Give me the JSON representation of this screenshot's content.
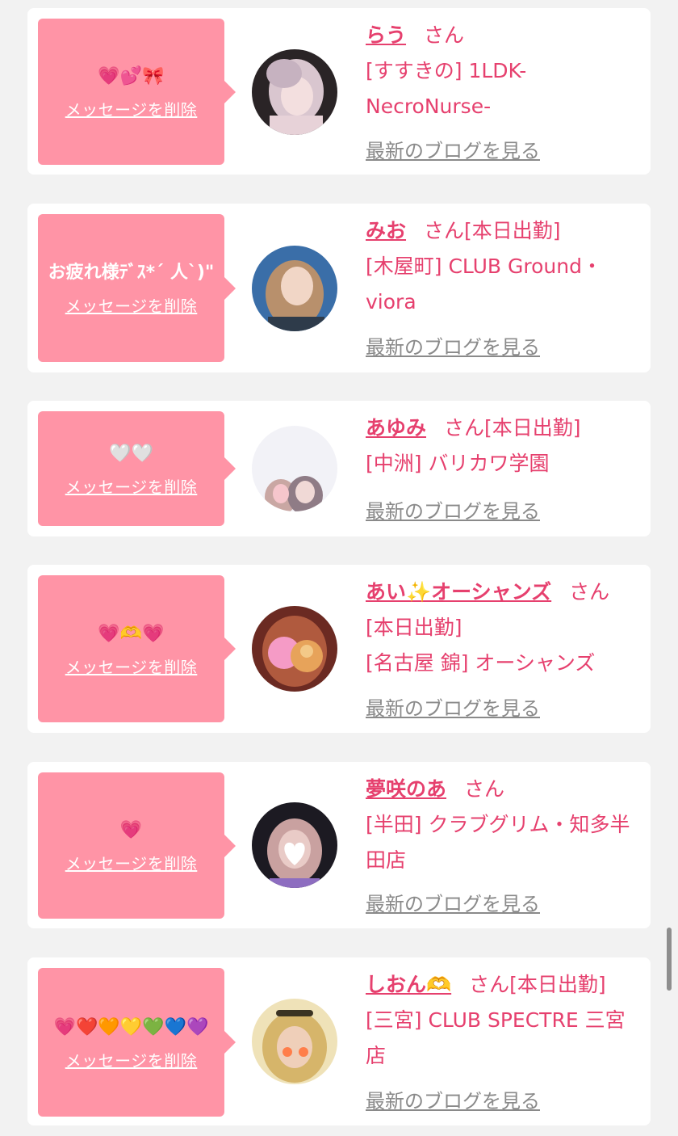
{
  "cards": [
    {
      "message": "💗💕🎀",
      "delete_label": "メッセージを削除",
      "name": "らう",
      "suffix": "さん",
      "shift": "",
      "shop": "[すすきの] 1LDK-NecroNurse-",
      "blog_label": "最新のブログを見る"
    },
    {
      "message": "お疲れ様ﾃﾞｽ*´ 人`)\"",
      "delete_label": "メッセージを削除",
      "name": "みお",
      "suffix": "さん",
      "shift": "[本日出勤]",
      "shop": "[木屋町] CLUB Ground・viora",
      "blog_label": "最新のブログを見る"
    },
    {
      "message": "🤍🤍",
      "delete_label": "メッセージを削除",
      "name": "あゆみ",
      "suffix": "さん",
      "shift": "[本日出勤]",
      "shop": "[中洲] バリカワ学園",
      "blog_label": "最新のブログを見る"
    },
    {
      "message": "💗🫶💗",
      "delete_label": "メッセージを削除",
      "name": "あい✨オーシャンズ",
      "suffix": "さん",
      "shift": "[本日出勤]",
      "shop": "[名古屋 錦] オーシャンズ",
      "blog_label": "最新のブログを見る"
    },
    {
      "message": "💗",
      "delete_label": "メッセージを削除",
      "name": "夢咲のあ",
      "suffix": "さん",
      "shift": "",
      "shop": "[半田] クラブグリム・知多半田店",
      "blog_label": "最新のブログを見る"
    },
    {
      "message": "💗❤️🧡💛💚💙💜",
      "delete_label": "メッセージを削除",
      "name": "しおん🫶",
      "suffix": "さん",
      "shift": "[本日出勤]",
      "shop": "[三宮] CLUB SPECTRE 三宮店",
      "blog_label": "最新のブログを見る"
    }
  ],
  "colors": {
    "accent": "#e6406e",
    "bubble": "#ff94a6",
    "link_gray": "#8a8a8a",
    "background": "#f2f2f2"
  }
}
